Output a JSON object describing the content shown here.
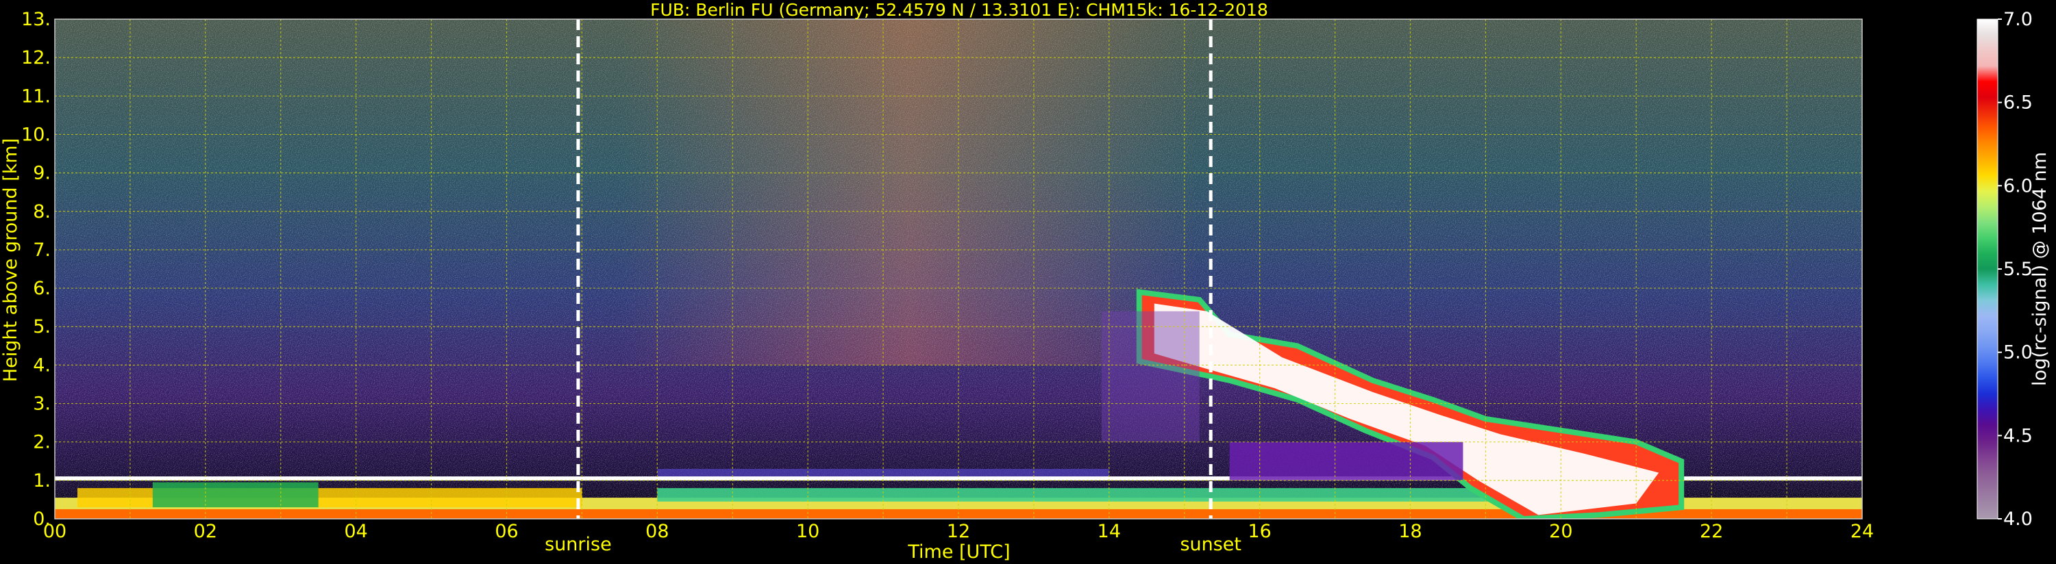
{
  "chart_data": {
    "type": "heatmap",
    "title": "FUB: Berlin FU (Germany; 52.4579 N / 13.3101 E):    CHM15k: 16-12-2018",
    "xlabel": "Time [UTC]",
    "ylabel": "Height above ground [km]",
    "xlim": [
      0,
      24
    ],
    "ylim": [
      0,
      13
    ],
    "x_ticks": [
      "00",
      "02",
      "04",
      "06",
      "08",
      "10",
      "12",
      "14",
      "16",
      "18",
      "20",
      "22",
      "24"
    ],
    "y_ticks": [
      "0.",
      "1.",
      "2.",
      "3.",
      "4.",
      "5.",
      "6.",
      "7.",
      "8.",
      "9.",
      "10.",
      "11.",
      "12.",
      "13."
    ],
    "grid": true,
    "markers": [
      {
        "label": "sunrise",
        "x": 6.95
      },
      {
        "label": "sunset",
        "x": 15.35
      }
    ],
    "colorbar": {
      "label": "log(rc-signal) @ 1064 nm",
      "range": [
        4.0,
        7.0
      ],
      "ticks": [
        "4.0",
        "4.5",
        "5.0",
        "5.5",
        "6.0",
        "6.5",
        "7.0"
      ],
      "colors": [
        "#a99aae",
        "#9f85a6",
        "#95709e",
        "#8b5a96",
        "#7f3e91",
        "#6a1f8a",
        "#5a0c90",
        "#3b14b4",
        "#1b2ed6",
        "#2c56e8",
        "#4f7af0",
        "#6f95f2",
        "#8aa9f3",
        "#9db7f4",
        "#7fc9da",
        "#3dbfa4",
        "#139a5a",
        "#1fb05a",
        "#46cf6c",
        "#7fe07d",
        "#b7ee6b",
        "#e6f24a",
        "#ffd900",
        "#ffb000",
        "#ff8a00",
        "#ff5a00",
        "#f02c0a",
        "#e0000c",
        "#ff0000",
        "#f5b5b5",
        "#f0c8c8",
        "#e8e0e0",
        "#ffffff"
      ]
    },
    "features": [
      {
        "kind": "aerosol_layer",
        "t0": 0.0,
        "t1": 24.0,
        "top_km": 1.05
      },
      {
        "kind": "cloud",
        "t0": 14.4,
        "t1": 21.6,
        "top_km": 5.9
      }
    ]
  }
}
